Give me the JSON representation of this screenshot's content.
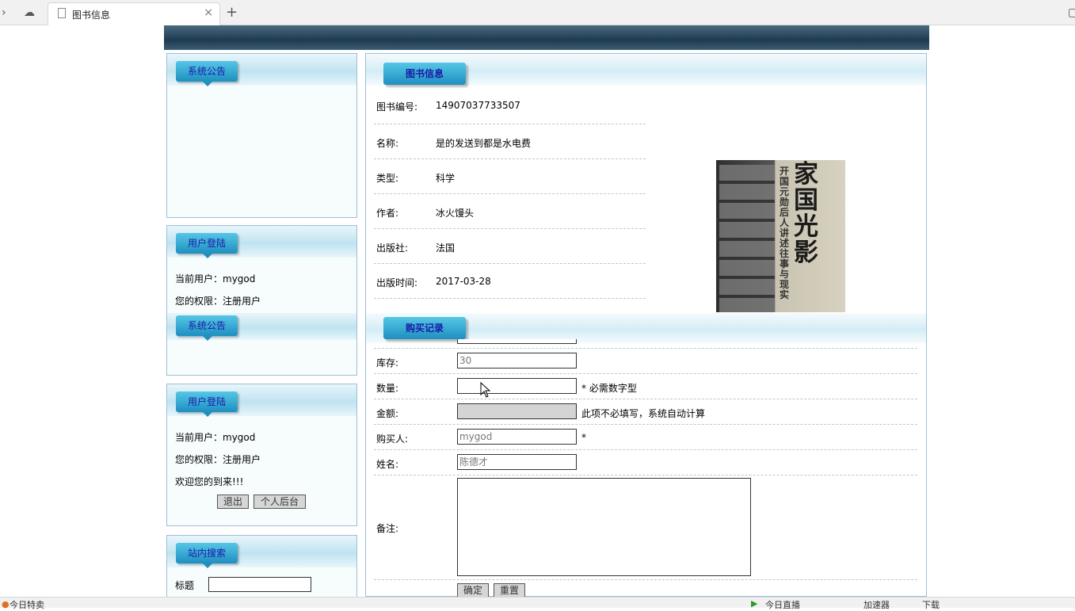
{
  "browser": {
    "tab_title": "图书信息",
    "new_tab": "+",
    "close": "×"
  },
  "sidebar": {
    "notice1_title": "系统公告",
    "login1_title": "用户登陆",
    "login1_user": "当前用户：mygod",
    "login1_role": "您的权限：注册用户",
    "notice2_title": "系统公告",
    "login2_title": "用户登陆",
    "login2_user": "当前用户：mygod",
    "login2_role": "您的权限：注册用户",
    "welcome": "欢迎您的到来!!!",
    "logout_btn": "退出",
    "backend_btn": "个人后台",
    "search_title": "站内搜索",
    "search_label": "标题"
  },
  "book": {
    "section_title": "图书信息",
    "fields": [
      {
        "label": "图书编号:",
        "value": "14907037733507"
      },
      {
        "label": "名称:",
        "value": "是的发送到都是水电费"
      },
      {
        "label": "类型:",
        "value": "科学"
      },
      {
        "label": "作者:",
        "value": "冰火馒头"
      },
      {
        "label": "出版社:",
        "value": "法国"
      },
      {
        "label": "出版时间:",
        "value": "2017-03-28"
      }
    ],
    "cover_title": "家国光影",
    "cover_subtitle": "开国元勋后人讲述往事与现实"
  },
  "purchase": {
    "section_title": "购买记录",
    "stock_label": "库存:",
    "stock_value": "30",
    "qty_label": "数量:",
    "qty_hint": "* 必需数字型",
    "amount_label": "金额:",
    "amount_hint": "此项不必填写，系统自动计算",
    "buyer_label": "购买人:",
    "buyer_value": "mygod",
    "buyer_hint": "*",
    "name_label": "姓名:",
    "name_value": "陈德才",
    "remark_label": "备注:",
    "submit_btn": "确定",
    "reset_btn": "重置"
  },
  "statusbar": {
    "left": "今日特卖",
    "live": "今日直播",
    "accel": "加速器",
    "download": "下载"
  }
}
